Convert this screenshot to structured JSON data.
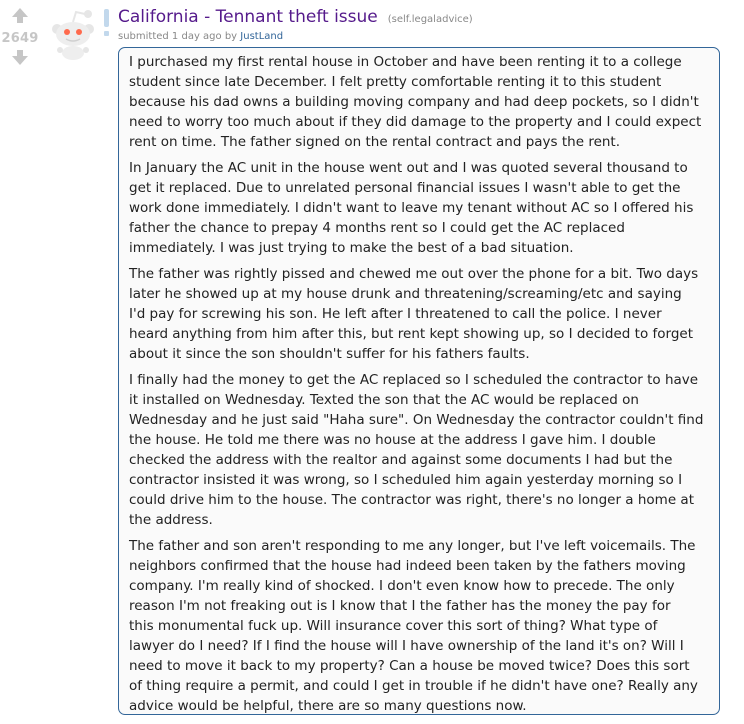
{
  "post": {
    "score": "2649",
    "title": "California - Tennant theft issue",
    "domain": "(self.legaladvice)",
    "tagline": {
      "submitted": "submitted 1 day ago by",
      "author": "JustLand"
    },
    "paragraphs": [
      [
        "I purchased my first rental house in October and have been renting it to a college",
        "student since late December. I felt pretty comfortable renting it to this student",
        "because his dad owns a building moving company and had deep pockets, so I didn't",
        "need to worry too much about if they did damage to the property and I could expect",
        "rent on time. The father signed on the rental contract and pays the rent."
      ],
      [
        "In January the AC unit in the house went out and I was quoted several thousand to",
        "get it replaced. Due to unrelated personal financial issues I wasn't able to get the",
        "work done immediately. I didn't want to leave my tenant without AC so I offered his",
        "father the chance to prepay 4 months rent so I could get the AC replaced",
        "immediately. I was just trying to make the best of a bad situation."
      ],
      [
        "The father was rightly pissed and chewed me out over the phone for a bit. Two days",
        "later he showed up at my house drunk and threatening/screaming/etc and saying",
        "I'd pay for screwing his son. He left after I threatened to call the police. I never",
        "heard anything from him after this, but rent kept showing up, so I decided to forget",
        "about it since the son shouldn't suffer for his fathers faults."
      ],
      [
        "I finally had the money to get the AC replaced so I scheduled the contractor to have",
        "it installed on Wednesday. Texted the son that the AC would be replaced on",
        "Wednesday and he just said \"Haha sure\". On Wednesday the contractor couldn't find",
        "the house. He told me there was no house at the address I gave him. I double",
        "checked the address with the realtor and against some documents I had but the",
        "contractor insisted it was wrong, so I scheduled him again yesterday morning so I",
        "could drive him to the house. The contractor was right, there's no longer a home at",
        "the address."
      ],
      [
        "The father and son aren't responding to me any longer, but I've left voicemails. The",
        "neighbors confirmed that the house had indeed been taken by the fathers moving",
        "company. I'm really kind of shocked. I don't even know how to precede. The only",
        "reason I'm not freaking out is I know that I the father has the money the pay for",
        "this monumental fuck up. Will insurance cover this sort of thing? What type of",
        "lawyer do I need? If I find the house will I have ownership of the land it's on? Will I",
        "need to move it back to my property? Can a house be moved twice? Does this sort",
        "of thing require a permit, and could I get in trouble if he didn't have one? Really any",
        "advice would be helpful, there are so many questions now."
      ]
    ]
  },
  "icons": {
    "upvote": "upvote-arrow-icon",
    "downvote": "downvote-arrow-icon",
    "thumbnail": "reddit-alien-self-post-icon",
    "self_marker": "exclamation-icon"
  },
  "colors": {
    "title": "#551a8b",
    "author": "#336699",
    "border": "#336699",
    "text": "#222222",
    "muted": "#888888",
    "vote": "#c6c6c6"
  }
}
